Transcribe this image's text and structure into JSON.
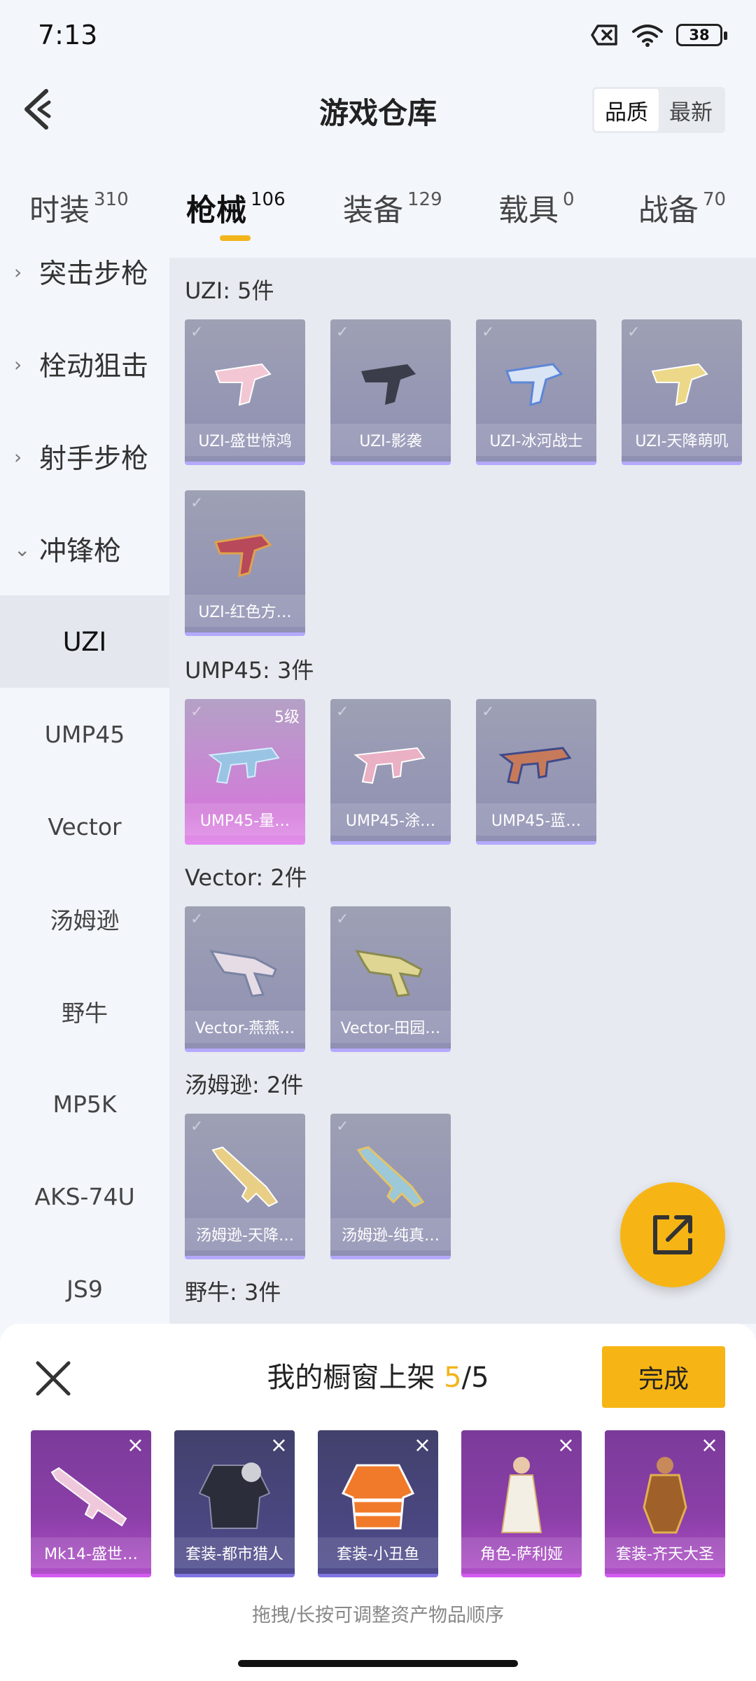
{
  "status_bar": {
    "time": "7:13",
    "battery": "38"
  },
  "header": {
    "title": "游戏仓库",
    "sort_options": [
      "品质",
      "最新"
    ],
    "sort_selected": "品质"
  },
  "tabs": [
    {
      "label": "时装",
      "count": "310"
    },
    {
      "label": "枪械",
      "count": "106"
    },
    {
      "label": "装备",
      "count": "129"
    },
    {
      "label": "载具",
      "count": "0"
    },
    {
      "label": "战备",
      "count": "70"
    }
  ],
  "active_tab": "枪械",
  "sidebar": {
    "categories": [
      "突击步枪",
      "栓动狙击",
      "射手步枪",
      "冲锋枪"
    ],
    "expanded_category": "冲锋枪",
    "subitems": [
      "UZI",
      "UMP45",
      "Vector",
      "汤姆逊",
      "野牛",
      "MP5K",
      "AKS-74U",
      "JS9"
    ],
    "selected_subitem": "UZI"
  },
  "groups": [
    {
      "title": "UZI: 5件",
      "items": [
        {
          "name": "UZI-盛世惊鸿"
        },
        {
          "name": "UZI-影袭"
        },
        {
          "name": "UZI-冰河战士"
        },
        {
          "name": "UZI-天降萌叽"
        },
        {
          "name": "UZI-红色方…"
        }
      ]
    },
    {
      "title": "UMP45: 3件",
      "items": [
        {
          "name": "UMP45-量…",
          "level": "5级"
        },
        {
          "name": "UMP45-涂…"
        },
        {
          "name": "UMP45-蓝…"
        }
      ]
    },
    {
      "title": "Vector: 2件",
      "items": [
        {
          "name": "Vector-燕燕…"
        },
        {
          "name": "Vector-田园…"
        }
      ]
    },
    {
      "title": "汤姆逊: 2件",
      "items": [
        {
          "name": "汤姆逊-天降…"
        },
        {
          "name": "汤姆逊-纯真…"
        }
      ]
    },
    {
      "title": "野牛: 3件",
      "items": []
    }
  ],
  "showcase": {
    "title_prefix": "我的橱窗上架 ",
    "current": "5",
    "total": "/5",
    "done_label": "完成",
    "items": [
      {
        "name": "Mk14-盛世…"
      },
      {
        "name": "套装-都市猎人"
      },
      {
        "name": "套装-小丑鱼"
      },
      {
        "name": "角色-萨利娅"
      },
      {
        "name": "套装-齐天大圣"
      }
    ],
    "hint": "拖拽/长按可调整资产物品顺序"
  },
  "colors": {
    "accent": "#f6b514",
    "item_purple": "#9ea0b4",
    "item_pink": "#d27bd9"
  },
  "icons": {
    "back": "chevron-left-icon",
    "share": "external-link-icon",
    "close": "close-icon"
  }
}
